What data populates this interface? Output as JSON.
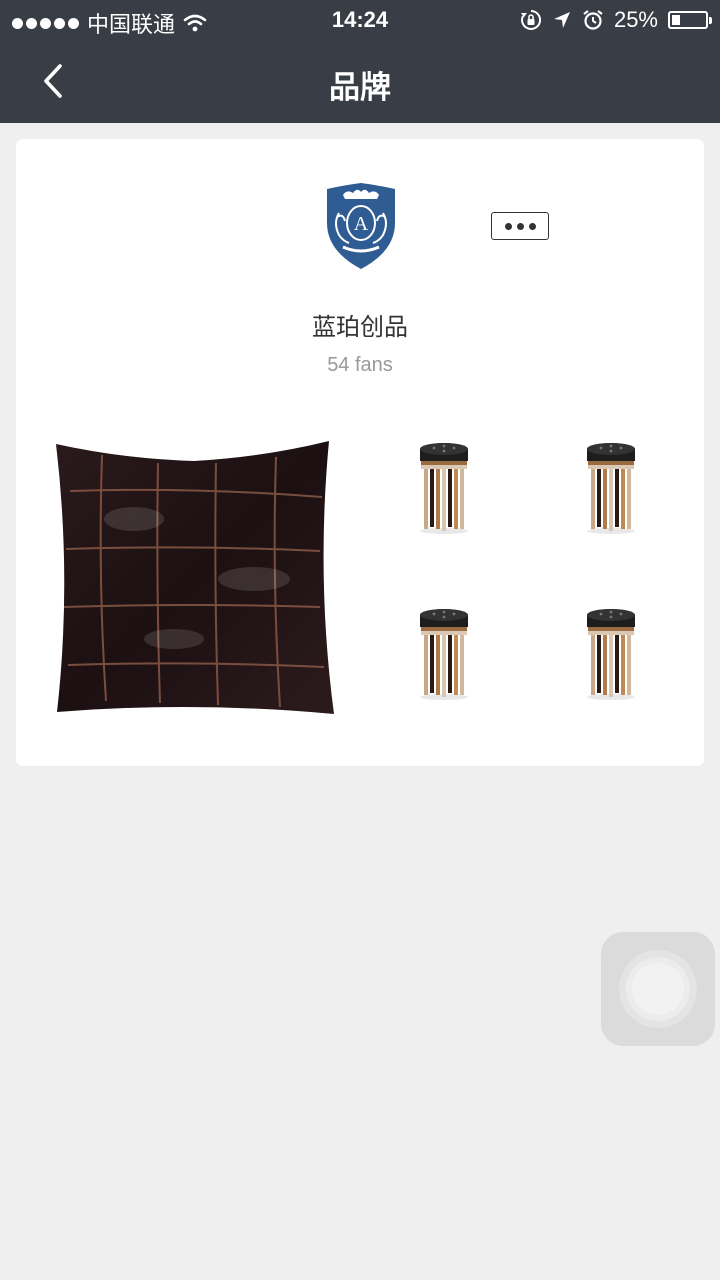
{
  "status_bar": {
    "carrier": "中国联通",
    "time": "14:24",
    "battery_percent": "25%",
    "battery_level": 0.25,
    "icons": [
      "signal-dots-icon",
      "wifi-icon",
      "rotation-lock-icon",
      "location-icon",
      "alarm-icon",
      "battery-icon"
    ]
  },
  "nav": {
    "title": "品牌",
    "back_icon": "chevron-left-icon"
  },
  "brand": {
    "name": "蓝珀创品",
    "fans": "54 fans",
    "logo_letter": "A",
    "logo_color": "#2f5d93",
    "more_icon": "more-dots-icon"
  },
  "products": [
    {
      "kind": "leather-pillow-image"
    },
    {
      "kind": "wooden-stool-image"
    },
    {
      "kind": "wooden-stool-image"
    },
    {
      "kind": "wooden-stool-image"
    },
    {
      "kind": "wooden-stool-image"
    }
  ],
  "colors": {
    "header_bg": "#393d45",
    "page_bg": "#efefef",
    "card_bg": "#ffffff"
  }
}
